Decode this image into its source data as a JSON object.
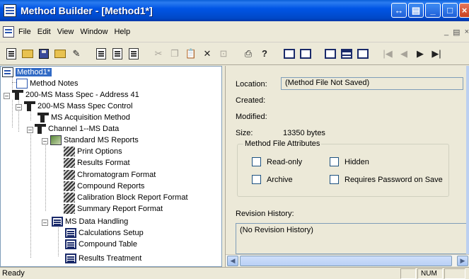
{
  "window": {
    "title": "Method Builder - [Method1*]"
  },
  "menu": {
    "items": [
      "File",
      "Edit",
      "View",
      "Window",
      "Help"
    ],
    "doc_controls": [
      "_",
      "×"
    ]
  },
  "toolbar": {
    "buttons": [
      "new",
      "open",
      "save",
      "open-folder",
      "edit",
      "report-a",
      "report-b",
      "report-c",
      "cut",
      "copy",
      "paste",
      "delete",
      "export",
      "print",
      "help",
      "view-a",
      "view-b",
      "view-c",
      "view-d",
      "view-e",
      "first",
      "prev",
      "next",
      "last"
    ]
  },
  "tree": {
    "nodes": [
      {
        "label": "Method1*",
        "icon": "method-icon",
        "selected": true
      },
      {
        "label": "Method Notes",
        "icon": "notes-icon"
      },
      {
        "label": "200-MS Mass Spec - Address 41",
        "icon": "ms-device-icon"
      },
      {
        "label": "200-MS Mass Spec Control",
        "icon": "ms-device-icon"
      },
      {
        "label": "MS Acquisition Method",
        "icon": "ms-device-icon"
      },
      {
        "label": "Channel 1--MS Data",
        "icon": "ms-device-icon"
      },
      {
        "label": "Standard MS Reports",
        "icon": "reports-icon"
      },
      {
        "label": "Print Options",
        "icon": "pencil-icon"
      },
      {
        "label": "Results Format",
        "icon": "pencil-icon"
      },
      {
        "label": "Chromatogram Format",
        "icon": "pencil-icon"
      },
      {
        "label": "Compound Reports",
        "icon": "pencil-icon"
      },
      {
        "label": "Calibration Block Report Format",
        "icon": "pencil-icon"
      },
      {
        "label": "Summary Report Format",
        "icon": "pencil-icon"
      },
      {
        "label": "MS Data Handling",
        "icon": "calc-icon"
      },
      {
        "label": "Calculations Setup",
        "icon": "calc-icon"
      },
      {
        "label": "Compound Table",
        "icon": "calc-icon"
      },
      {
        "label": "Results Treatment",
        "icon": "calc-icon"
      }
    ]
  },
  "detail": {
    "location_label": "Location:",
    "location_value": "(Method File Not Saved)",
    "created_label": "Created:",
    "modified_label": "Modified:",
    "size_label": "Size:",
    "size_value": "13350 bytes",
    "attributes_title": "Method File Attributes",
    "checkboxes": [
      "Read-only",
      "Hidden",
      "Archive",
      "Requires Password on Save"
    ],
    "revision_label": "Revision History:",
    "revision_value": "(No Revision History)"
  },
  "status": {
    "text": "Ready",
    "num": "NUM"
  }
}
